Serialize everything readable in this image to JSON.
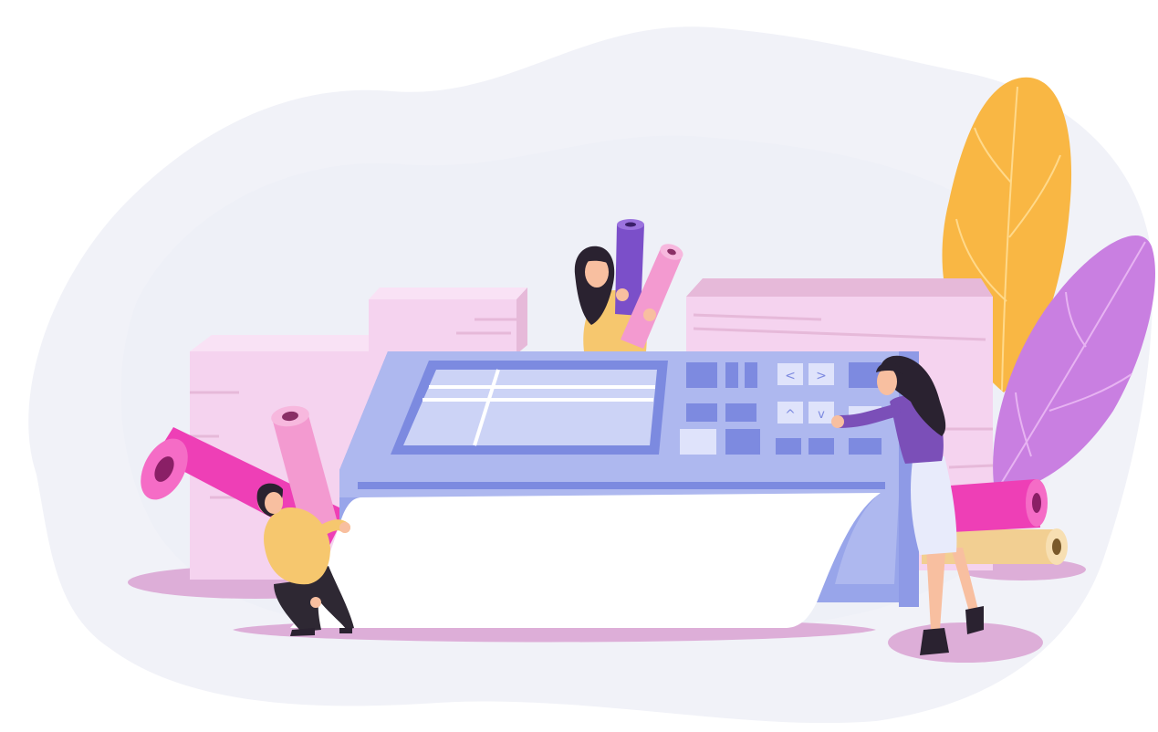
{
  "illustration": {
    "subject": "large-format-printer-scene",
    "palette": {
      "background_blob": "#f1f2f8",
      "background_blob_inner": "#eceef7",
      "printer_body": "#aeb8ef",
      "printer_body_dark": "#8e9ae6",
      "printer_side": "#98a5ea",
      "printer_screen_frame": "#7c8ae0",
      "printer_screen": "#ccd3f6",
      "printer_key": "#7d8ae0",
      "printer_key_light": "#dfe3fb",
      "paper": "#ffffff",
      "paper_box": "#f5d3ef",
      "paper_box_top": "#f9e2f5",
      "paper_box_right": "#e6b9d9",
      "roll_magenta": "#ee3fb6",
      "roll_pink": "#f39ad0",
      "roll_violet": "#7b4fc9",
      "roll_tan": "#f2cf92",
      "leaf_orange": "#f9b744",
      "leaf_purple": "#c97fe1",
      "floor_shadow": "#ddaed8",
      "shirt_yellow": "#f6c76e",
      "shirt_violet": "#7b4fb8",
      "skirt_light": "#e8ebfb",
      "skin": "#f8bfa0",
      "hair": "#2a2230",
      "pants_dark": "#2e2833"
    },
    "keypad_glyphs": {
      "left": "<",
      "right": ">",
      "up": "^",
      "down": "v"
    }
  }
}
